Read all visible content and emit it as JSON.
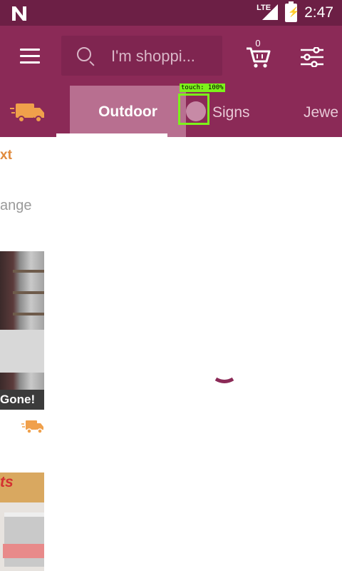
{
  "status_bar": {
    "network_label": "LTE",
    "time": "2:47"
  },
  "app_bar": {
    "search_placeholder": "I'm shoppi...",
    "cart_count": "0"
  },
  "tabs": {
    "items": [
      {
        "label": "Outdoor",
        "active": true
      },
      {
        "label": "Signs",
        "active": false
      },
      {
        "label": "Jewe",
        "active": false
      }
    ]
  },
  "touch_overlay": {
    "label": "touch: 100%"
  },
  "left_panel": {
    "heading_fragment": "xt",
    "subtitle_fragment": "ange",
    "promo_badge": "Gone!",
    "photo2_text_fragment": "ts"
  },
  "colors": {
    "status_bar": "#6c1f45",
    "app_bar": "#8b2a57",
    "tab_active": "#b86f90",
    "accent_orange": "#e08a3c",
    "touch_highlight": "#7cf21a"
  },
  "icons": {
    "logo": "n-logo-icon",
    "signal": "lte-signal-icon",
    "battery": "battery-charging-icon",
    "menu": "hamburger-menu-icon",
    "search": "search-icon",
    "cart": "shopping-cart-icon",
    "filter": "filter-sliders-icon",
    "delivery": "delivery-truck-icon",
    "loading": "loading-spinner-icon"
  }
}
